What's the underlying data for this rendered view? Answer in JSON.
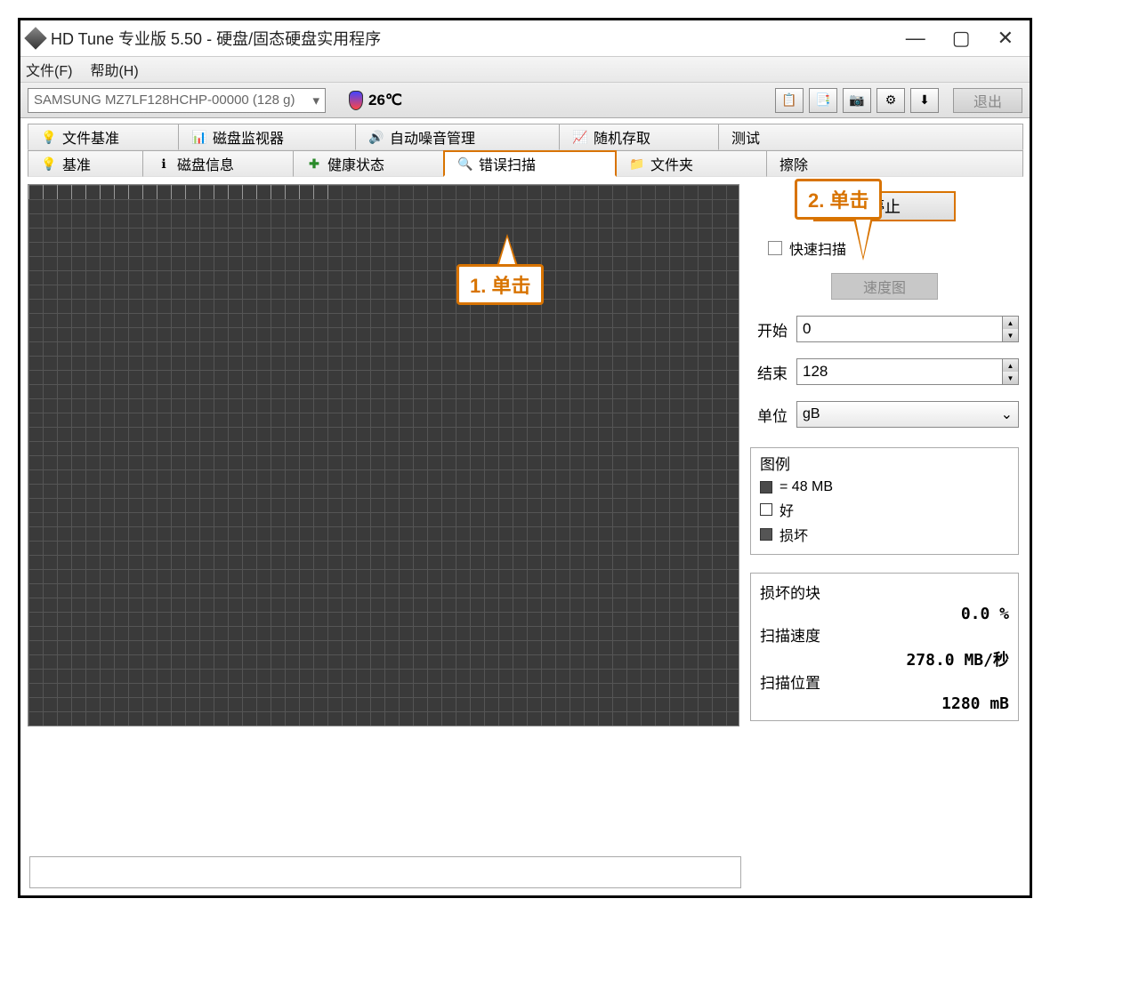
{
  "window": {
    "title": "HD Tune 专业版 5.50 - 硬盘/固态硬盘实用程序"
  },
  "menubar": {
    "file": "文件(F)",
    "help": "帮助(H)"
  },
  "toolbar": {
    "drive": "SAMSUNG MZ7LF128HCHP-00000 (128 g)",
    "temperature": "26℃",
    "exit": "退出"
  },
  "tabs_row1": {
    "file_benchmark": "文件基准",
    "disk_monitor": "磁盘监视器",
    "auto_noise": "自动噪音管理",
    "random_access": "随机存取",
    "extra_test": "测试"
  },
  "tabs_row2": {
    "benchmark": "基准",
    "info": "磁盘信息",
    "health": "健康状态",
    "error_scan": "错误扫描",
    "folder": "文件夹",
    "erase": "擦除"
  },
  "right": {
    "stop": "停止",
    "quick_scan": "快速扫描",
    "speed_map": "速度图",
    "start_label": "开始",
    "start_val": "0",
    "end_label": "结束",
    "end_val": "128",
    "unit_label": "单位",
    "unit_val": "gB"
  },
  "legend": {
    "title": "图例",
    "block_size": "= 48 MB",
    "ok": "好",
    "damaged": "损坏"
  },
  "stats": {
    "damaged_label": "损坏的块",
    "damaged_val": "0.0 %",
    "speed_label": "扫描速度",
    "speed_val": "278.0 MB/秒",
    "position_label": "扫描位置",
    "position_val": "1280 mB"
  },
  "callouts": {
    "c1": "1. 单击",
    "c2": "2. 单击"
  }
}
